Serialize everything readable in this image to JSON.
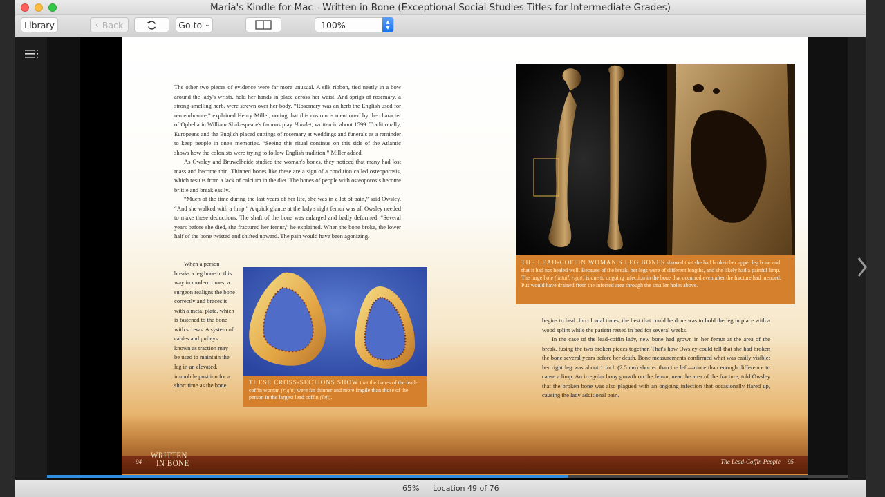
{
  "window": {
    "title": "Maria's Kindle for Mac - Written in Bone (Exceptional Social Studies Titles for Intermediate Grades)"
  },
  "toolbar": {
    "library_label": "Library",
    "back_label": "Back",
    "sync_icon": "sync-icon",
    "goto_label": "Go to",
    "layout_icon": "two-column-icon",
    "zoom_value": "100%"
  },
  "left_page": {
    "para1_a": "The other two pieces of evidence were far more unusual. A silk ribbon, tied neatly in a bow around the lady's wrists, held her hands in place across her waist. And sprigs of rosemary, a strong-smelling herb, were strewn over her body. “Rosemary was an herb the English used for remembrance,” explained Henry Miller, noting that this custom is mentioned by the character of Ophelia in William Shakespeare's famous play ",
    "para1_italic": "Hamlet",
    "para1_b": ", written in about 1599. Traditionally, Europeans and the English placed cuttings of rosemary at weddings and funerals as a reminder to keep people in one's memories. “Seeing this ritual continue on this side of the Atlantic shows how the colonists were trying to follow English tradition,” Miller added.",
    "para2": "As Owsley and Bruwelheide studied the woman's bones, they noticed that many had lost mass and become thin. Thinned bones like these are a sign of a condition called osteoporosis, which results from a lack of calcium in the diet. The bones of people with osteoporosis become brittle and break easily.",
    "para3": "“Much of the time during the last years of her life, she was in a lot of pain,” said Owsley. “And she walked with a limp.” A quick glance at the lady's right femur was all Owsley needed to make these deductions. The shaft of the bone was enlarged and badly deformed. “Several years before she died, she fractured her femur,” he explained. When the bone broke, the lower half of the bone twisted and shifted upward. The pain would have been agonizing.",
    "para4": "When a person breaks a leg bone in this way in modern times, a surgeon realigns the bone correctly and braces it with a metal plate, which is fastened to the bone with screws. A system of cables and pulleys known as traction may be used to maintain the leg in an elevated, immobile position for a short time as the bone",
    "caption_lead": "These cross-sections show",
    "caption_a": " that the bones of the lead-coffin woman ",
    "caption_it1": "(right)",
    "caption_b": " were far thinner and more fragile than those of the person in the largest lead coffin ",
    "caption_it2": "(left)",
    "caption_c": ".",
    "folio": "94—",
    "logo_line1": "WRITTEN",
    "logo_line2": "IN BONE"
  },
  "right_page": {
    "caption_lead": "The lead-coffin woman's leg bones",
    "caption_a": " showed that she had broken her upper leg bone and that it had not healed well. Because of the break, her legs were of different lengths, and she likely had a painful limp. The large hole ",
    "caption_it": "(detail, right)",
    "caption_b": " is due to ongoing infection in the bone that occurred even after the fracture had mended. Pus would have drained from the infected area through the smaller holes above.",
    "para1": "begins to heal. In colonial times, the best that could be done was to hold the leg in place with a wood splint while the patient rested in bed for several weeks.",
    "para2": "In the case of the lead-coffin lady, new bone had grown in her femur at the area of the break, fusing the two broken pieces together. That's how Owsley could tell that she had broken the bone several years before her death. Bone measurements confirmed what was easily visible: her right leg was about 1 inch (2.5 cm) shorter than the left—more than enough difference to cause a limp. An irregular bony growth on the femur, near the area of the fracture, told Owsley that the broken bone was also plagued with an ongoing infection that occasionally flared up, causing the lady additional pain.",
    "folio": "The Lead-Coffin People —95"
  },
  "status": {
    "percent": "65%",
    "location": "Location 49 of 76",
    "progress_fraction": 0.65
  },
  "colors": {
    "accent": "#2f8ee0",
    "caption_bg": "#d4802c",
    "footer_band": "#6b2810"
  }
}
